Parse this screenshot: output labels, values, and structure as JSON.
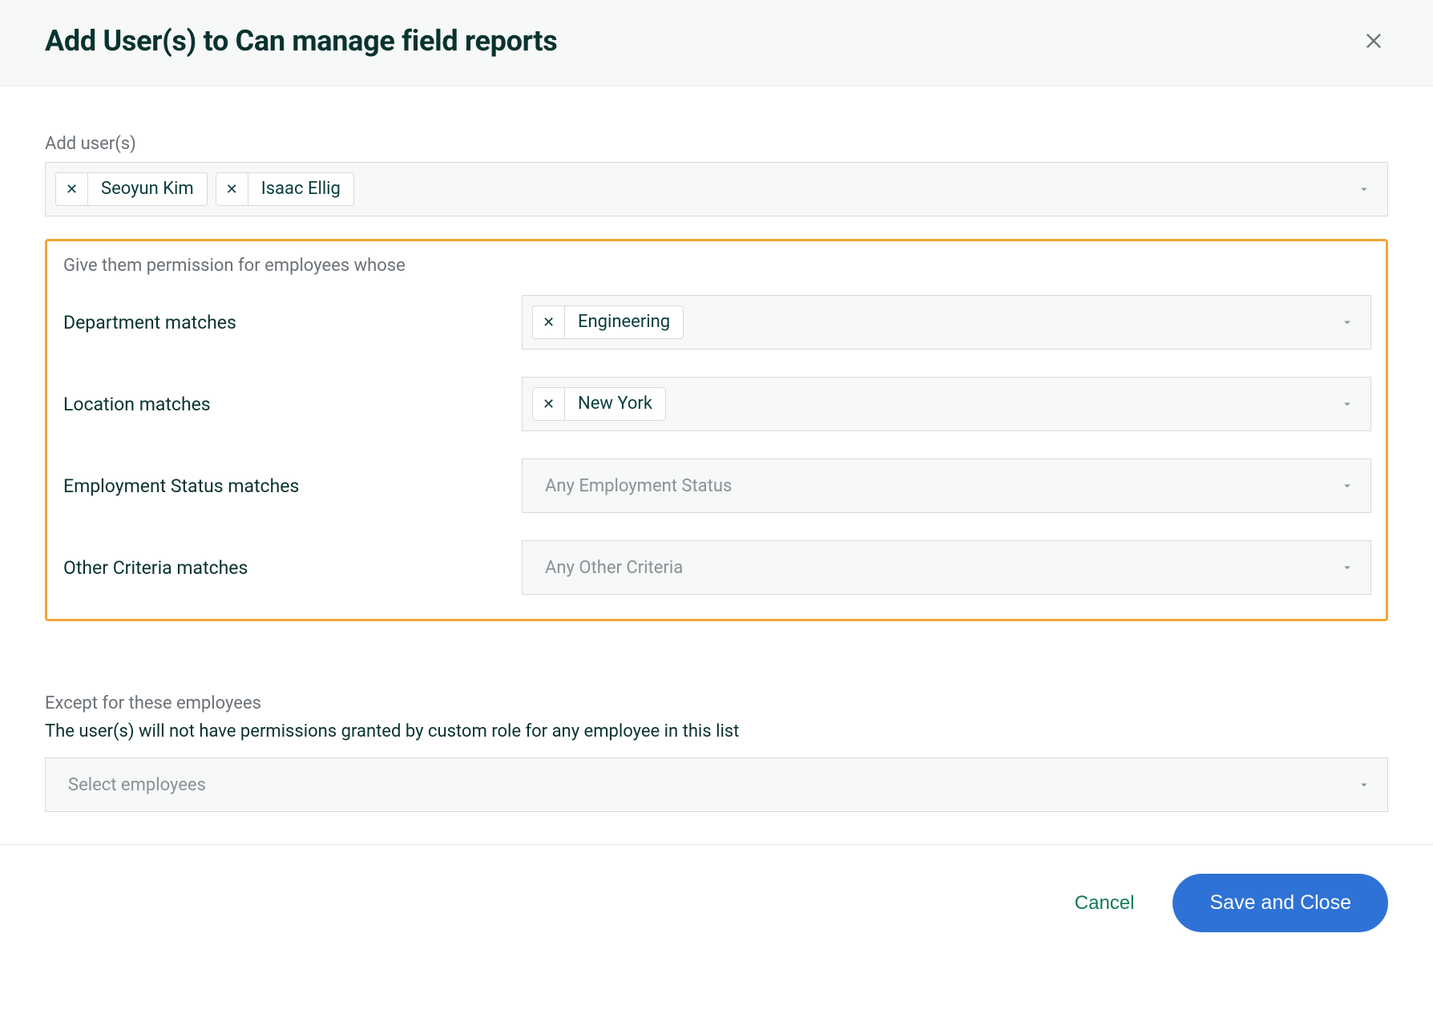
{
  "header": {
    "title": "Add User(s) to Can manage field reports"
  },
  "addUsers": {
    "label": "Add user(s)",
    "chips": [
      "Seoyun Kim",
      "Isaac Ellig"
    ]
  },
  "permissions": {
    "intro": "Give them permission for employees whose",
    "rows": {
      "department": {
        "label": "Department matches",
        "chips": [
          "Engineering"
        ],
        "placeholder": ""
      },
      "location": {
        "label": "Location matches",
        "chips": [
          "New York"
        ],
        "placeholder": ""
      },
      "employmentStatus": {
        "label": "Employment Status matches",
        "chips": [],
        "placeholder": "Any Employment Status"
      },
      "otherCriteria": {
        "label": "Other Criteria matches",
        "chips": [],
        "placeholder": "Any Other Criteria"
      }
    }
  },
  "except": {
    "label": "Except for these employees",
    "description": "The user(s) will not have permissions granted by custom role for any employee in this list",
    "placeholder": "Select employees"
  },
  "footer": {
    "cancel": "Cancel",
    "save": "Save and Close"
  }
}
